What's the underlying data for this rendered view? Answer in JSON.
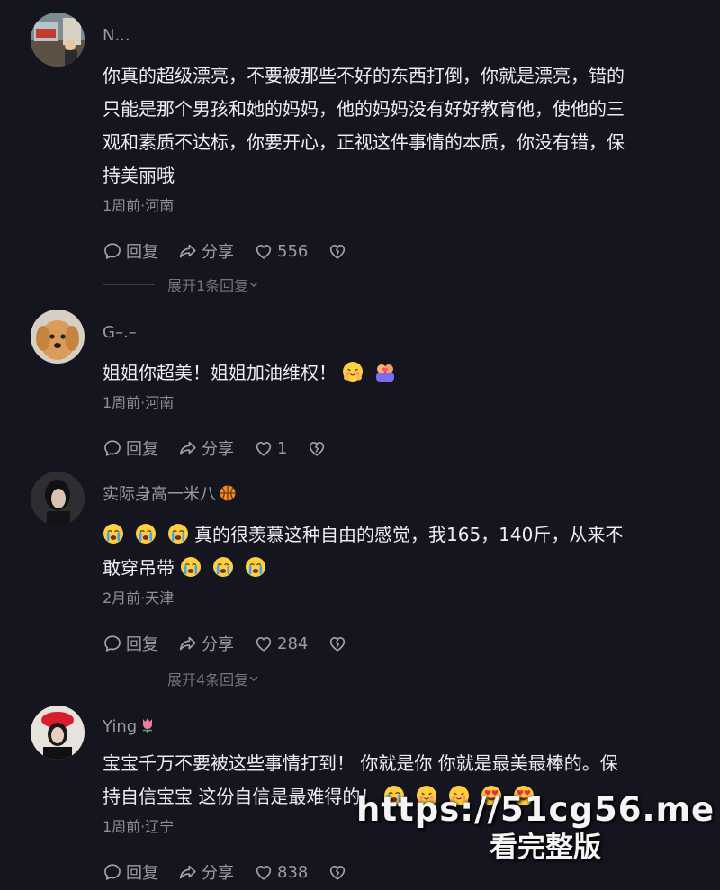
{
  "comments": [
    {
      "username": "N...",
      "text_lines": [
        "你真的超级漂亮，不要被那些不好的东西打倒，你就是漂亮，错的",
        "只能是那个男孩和她的妈妈，他的妈妈没有好好教育他，使他的三",
        "观和素质不达标，你要开心，正视这件事情的本质，你没有错，保",
        "持美丽哦"
      ],
      "meta": "1周前·河南",
      "reply_label": "回复",
      "share_label": "分享",
      "like_count": "556",
      "expand_label": "展开1条回复"
    },
    {
      "username": "G–.–",
      "text": "姐姐你超美！姐姐加油维权！",
      "emojis": [
        "hug-face-emoji",
        "couple-heart-emoji"
      ],
      "meta": "1周前·河南",
      "reply_label": "回复",
      "share_label": "分享",
      "like_count": "1"
    },
    {
      "username": "实际身高一米八",
      "username_badge": "basketball-icon",
      "line1_text": "真的很羡慕这种自由的感觉，我165，140斤，从来不",
      "line2_text": "敢穿吊带",
      "emojis": [
        "crying-face-emoji"
      ],
      "meta": "2月前·天津",
      "reply_label": "回复",
      "share_label": "分享",
      "like_count": "284",
      "expand_label": "展开4条回复"
    },
    {
      "username": "Ying",
      "username_badge": "tulip-icon",
      "line1_text": "宝宝千万不要被这些事情打到！ 你就是你 你就是最美最棒的。保",
      "line2_text": "持自信宝宝 这份自信是最难得的！",
      "emojis": [
        "crying-face-emoji",
        "hug-face-emoji",
        "heart-eyes-emoji"
      ],
      "meta": "1周前·辽宁",
      "reply_label": "回复",
      "share_label": "分享",
      "like_count": "838"
    }
  ],
  "watermark": {
    "url": "https://51cg56.me",
    "cta": "看完整版"
  },
  "colors": {
    "background": "#15151f",
    "text": "#ededf2",
    "muted": "#8e8e99"
  }
}
